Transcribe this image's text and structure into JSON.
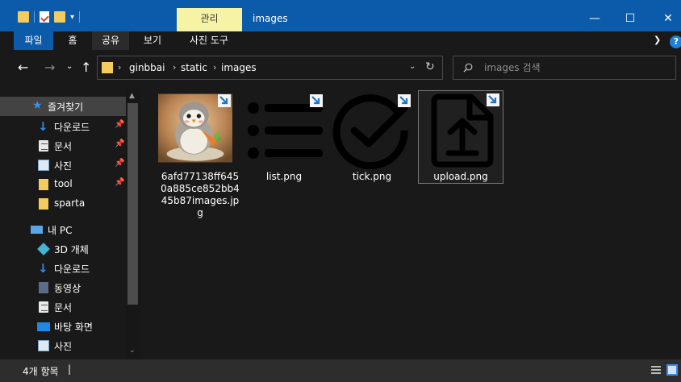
{
  "window": {
    "context_tab": "관리",
    "title": "images",
    "minimize": "—",
    "maximize": "☐",
    "close": "✕"
  },
  "ribbon": {
    "tabs": [
      {
        "label": "파일"
      },
      {
        "label": "홈"
      },
      {
        "label": "공유"
      },
      {
        "label": "보기"
      },
      {
        "label": "사진 도구"
      }
    ],
    "help": "?"
  },
  "address": {
    "crumbs": [
      "ginbbai",
      "static",
      "images"
    ]
  },
  "search": {
    "placeholder": "images 검색"
  },
  "sidebar": {
    "quick_access": "즐겨찾기",
    "quick_items": [
      {
        "label": "다운로드",
        "icon": "download-icon",
        "pinned": true
      },
      {
        "label": "문서",
        "icon": "document-icon",
        "pinned": true
      },
      {
        "label": "사진",
        "icon": "pictures-icon",
        "pinned": true
      },
      {
        "label": "tool",
        "icon": "folder-icon",
        "pinned": true
      },
      {
        "label": "sparta",
        "icon": "folder-icon",
        "pinned": false
      }
    ],
    "this_pc": "내 PC",
    "pc_items": [
      {
        "label": "3D 개체",
        "icon": "3d-objects-icon"
      },
      {
        "label": "다운로드",
        "icon": "download-icon"
      },
      {
        "label": "동영상",
        "icon": "video-icon"
      },
      {
        "label": "문서",
        "icon": "document-icon"
      },
      {
        "label": "바탕 화면",
        "icon": "desktop-icon"
      },
      {
        "label": "사진",
        "icon": "pictures-icon"
      }
    ]
  },
  "files": [
    {
      "name": "6afd77138ff6450a885ce852bb445b87images.jpg",
      "lines": [
        "6afd77138ff645",
        "0a885ce852bb4",
        "45b87images.jp",
        "g"
      ]
    },
    {
      "name": "list.png",
      "lines": [
        "list.png"
      ]
    },
    {
      "name": "tick.png",
      "lines": [
        "tick.png"
      ]
    },
    {
      "name": "upload.png",
      "lines": [
        "upload.png"
      ]
    }
  ],
  "status": {
    "item_count": "4개 항목"
  },
  "colors": {
    "titlebar": "#0b5baa",
    "context_tab": "#f7f3a6",
    "background": "#191919",
    "statusbar": "#2d2d2d",
    "accent": "#3d8ee9"
  }
}
